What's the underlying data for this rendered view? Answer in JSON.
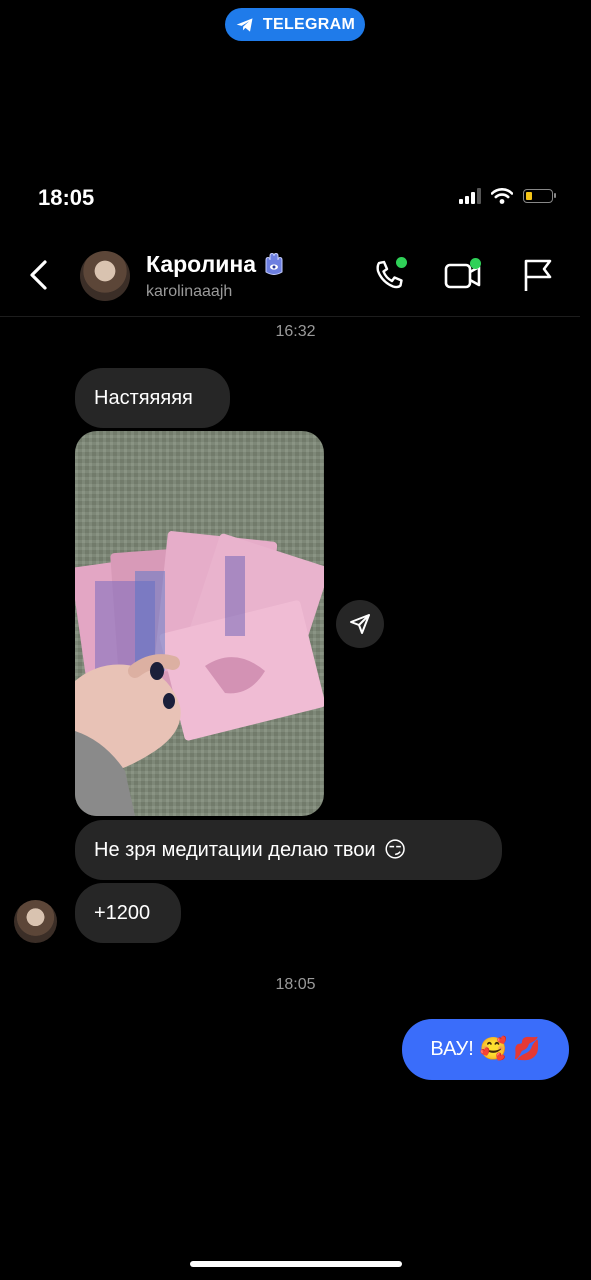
{
  "source_badge": {
    "label": "TELEGRAM"
  },
  "status_bar": {
    "time": "18:05",
    "battery_level": 0.2
  },
  "header": {
    "contact_name": "Каролина",
    "username": "karolinaaajh",
    "online_indicator_color": "#2fd158"
  },
  "messages": {
    "time_1": "16:32",
    "msg_1": "Настяяяяя",
    "msg_2_text": "Не зря медитации делаю твои",
    "msg_2_emoji": "😏",
    "msg_3": "+1200",
    "time_2": "18:05",
    "msg_out_text": "ВАУ!",
    "msg_out_emoji_1": "🥰",
    "msg_out_emoji_2": "💋"
  },
  "colors": {
    "incoming_bubble": "#262626",
    "outgoing_bubble": "#3a6dfa",
    "badge": "#1f7bea"
  }
}
